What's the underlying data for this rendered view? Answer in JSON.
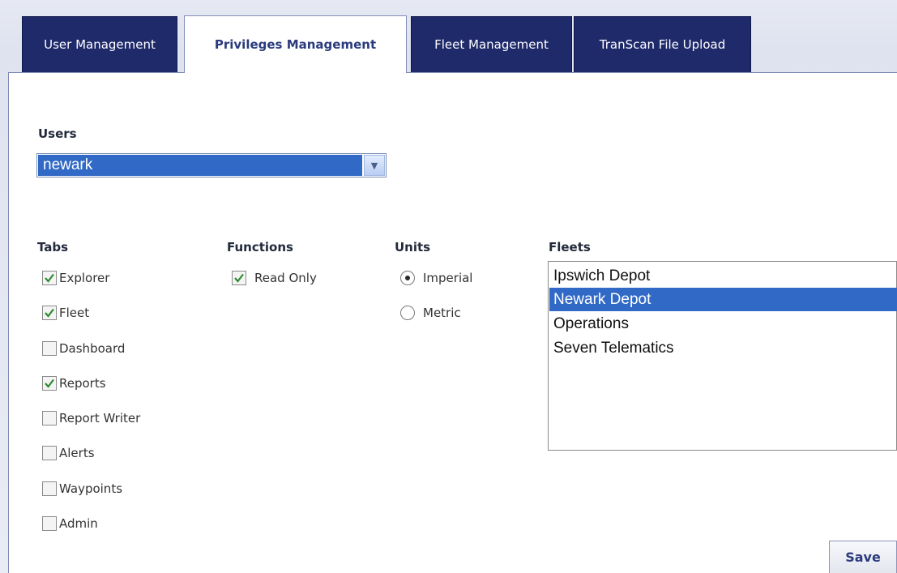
{
  "tabs": [
    {
      "label": "User Management"
    },
    {
      "label": "Privileges Management",
      "active": true
    },
    {
      "label": "Fleet Management"
    },
    {
      "label": "TranScan File Upload"
    }
  ],
  "users": {
    "label": "Users",
    "selected": "newark"
  },
  "tabs_section": {
    "label": "Tabs",
    "items": [
      {
        "label": "Explorer",
        "checked": true
      },
      {
        "label": "Fleet",
        "checked": true
      },
      {
        "label": "Dashboard",
        "checked": false
      },
      {
        "label": "Reports",
        "checked": true
      },
      {
        "label": "Report Writer",
        "checked": false
      },
      {
        "label": "Alerts",
        "checked": false
      },
      {
        "label": "Waypoints",
        "checked": false
      },
      {
        "label": "Admin",
        "checked": false
      }
    ]
  },
  "functions": {
    "label": "Functions",
    "items": [
      {
        "label": "Read Only",
        "checked": true
      }
    ]
  },
  "units": {
    "label": "Units",
    "options": [
      {
        "label": "Imperial",
        "selected": true
      },
      {
        "label": "Metric",
        "selected": false
      }
    ]
  },
  "fleets": {
    "label": "Fleets",
    "options": [
      "Ipswich Depot",
      "Newark Depot",
      "Operations",
      "Seven Telematics"
    ],
    "selected": "Newark Depot"
  },
  "save_label": "Save",
  "colors": {
    "tab_bg": "#1f2a6b",
    "selection": "#3169c6",
    "checkmark": "#2e8b2e"
  }
}
